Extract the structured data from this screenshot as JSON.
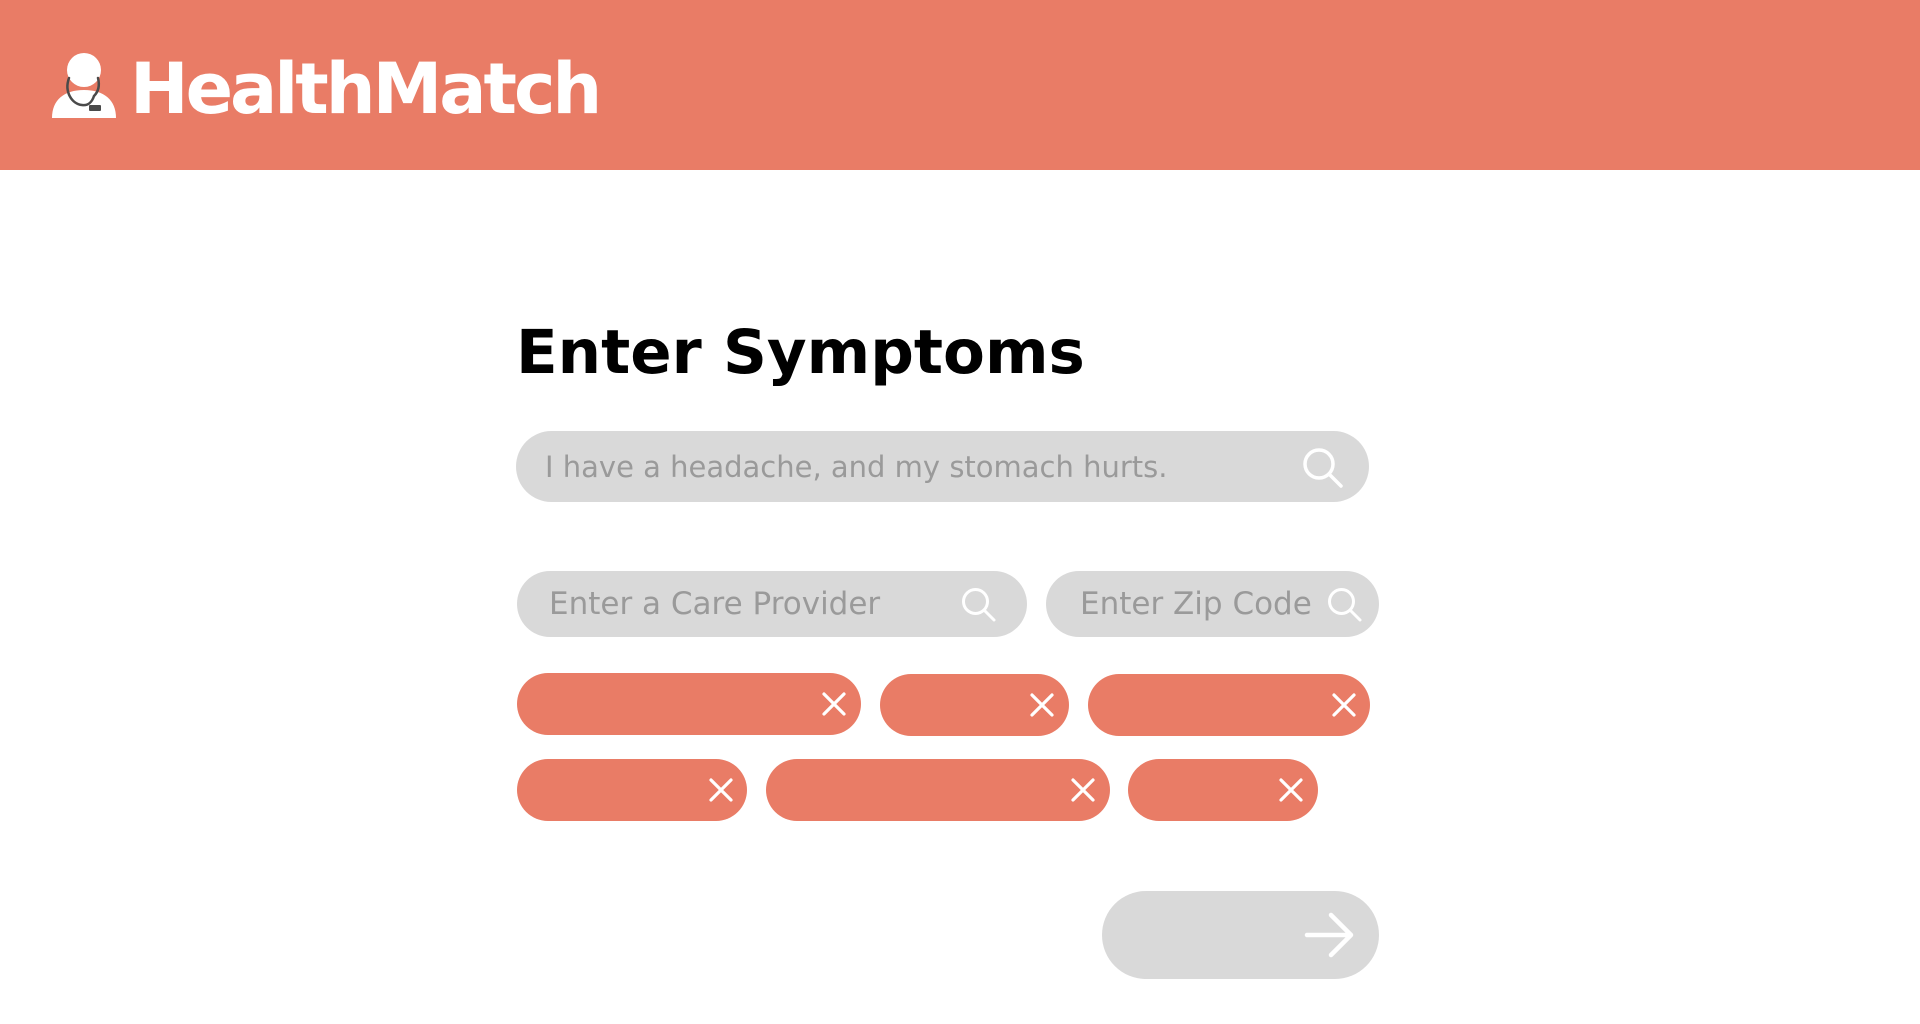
{
  "app": {
    "name": "HealthMatch",
    "logo_icon": "doctor-stethoscope-icon",
    "accent_color": "#E97C66"
  },
  "main": {
    "title": "Enter Symptoms",
    "symptom_input": {
      "value": "",
      "placeholder": "I have a headache, and my stomach hurts.",
      "icon": "search-icon"
    },
    "provider_input": {
      "value": "",
      "placeholder": "Enter a Care Provider",
      "icon": "search-icon"
    },
    "zip_input": {
      "value": "",
      "placeholder": "Enter Zip Code",
      "icon": "search-icon"
    },
    "chips": [
      {
        "label": "",
        "remove_icon": "close-icon"
      },
      {
        "label": "",
        "remove_icon": "close-icon"
      },
      {
        "label": "",
        "remove_icon": "close-icon"
      },
      {
        "label": "",
        "remove_icon": "close-icon"
      },
      {
        "label": "",
        "remove_icon": "close-icon"
      },
      {
        "label": "",
        "remove_icon": "close-icon"
      }
    ],
    "next_button": {
      "icon": "arrow-right-icon"
    }
  }
}
